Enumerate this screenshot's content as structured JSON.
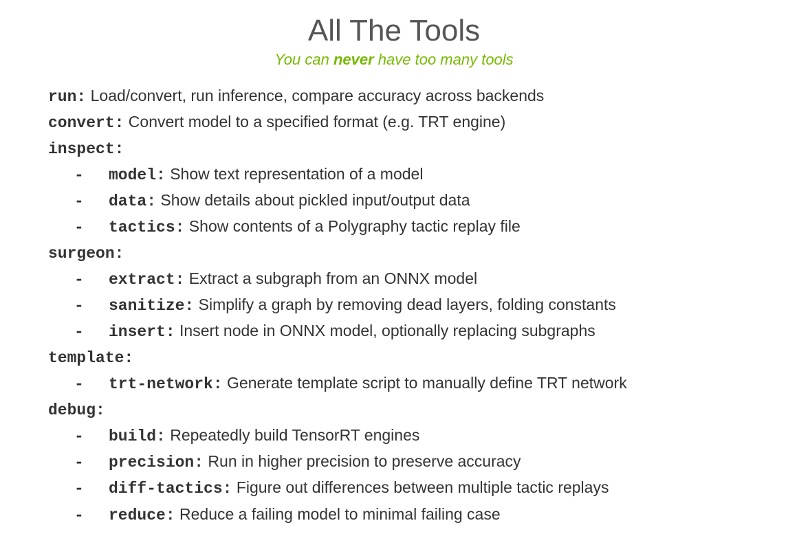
{
  "title": "All The Tools",
  "subtitle_pre": "You can ",
  "subtitle_emph": "never",
  "subtitle_post": " have too many tools",
  "tools": {
    "run": {
      "name": "run:",
      "desc": "  Load/convert, run inference, compare accuracy across backends"
    },
    "convert": {
      "name": "convert:",
      "desc": "  Convert model to a specified format (e.g. TRT engine)"
    },
    "inspect": {
      "name": "inspect:",
      "items": {
        "model": {
          "name": "model:",
          "desc": "  Show text representation of a model"
        },
        "data": {
          "name": "data:",
          "desc": "  Show details about pickled input/output data"
        },
        "tactics": {
          "name": "tactics:",
          "desc": "  Show contents of a Polygraphy tactic replay file"
        }
      }
    },
    "surgeon": {
      "name": "surgeon:",
      "items": {
        "extract": {
          "name": "extract:",
          "desc": " Extract a subgraph from an ONNX model"
        },
        "sanitize": {
          "name": "sanitize:",
          "desc": "  Simplify a graph by removing dead layers, folding constants"
        },
        "insert": {
          "name": "insert:",
          "desc": "  Insert node in ONNX model, optionally replacing subgraphs"
        }
      }
    },
    "template": {
      "name": "template:",
      "items": {
        "trtnetwork": {
          "name": "trt-network:",
          "desc": "  Generate template script to manually define TRT network"
        }
      }
    },
    "debug": {
      "name": "debug:",
      "items": {
        "build": {
          "name": "build:",
          "desc": "  Repeatedly build TensorRT engines"
        },
        "precision": {
          "name": "precision:",
          "desc": "  Run in higher precision to preserve accuracy"
        },
        "difftactics": {
          "name": "diff-tactics:",
          "desc": "  Figure out differences between multiple tactic replays"
        },
        "reduce": {
          "name": "reduce:",
          "desc": "  Reduce a failing model to minimal failing case"
        }
      }
    }
  },
  "dash": "-"
}
